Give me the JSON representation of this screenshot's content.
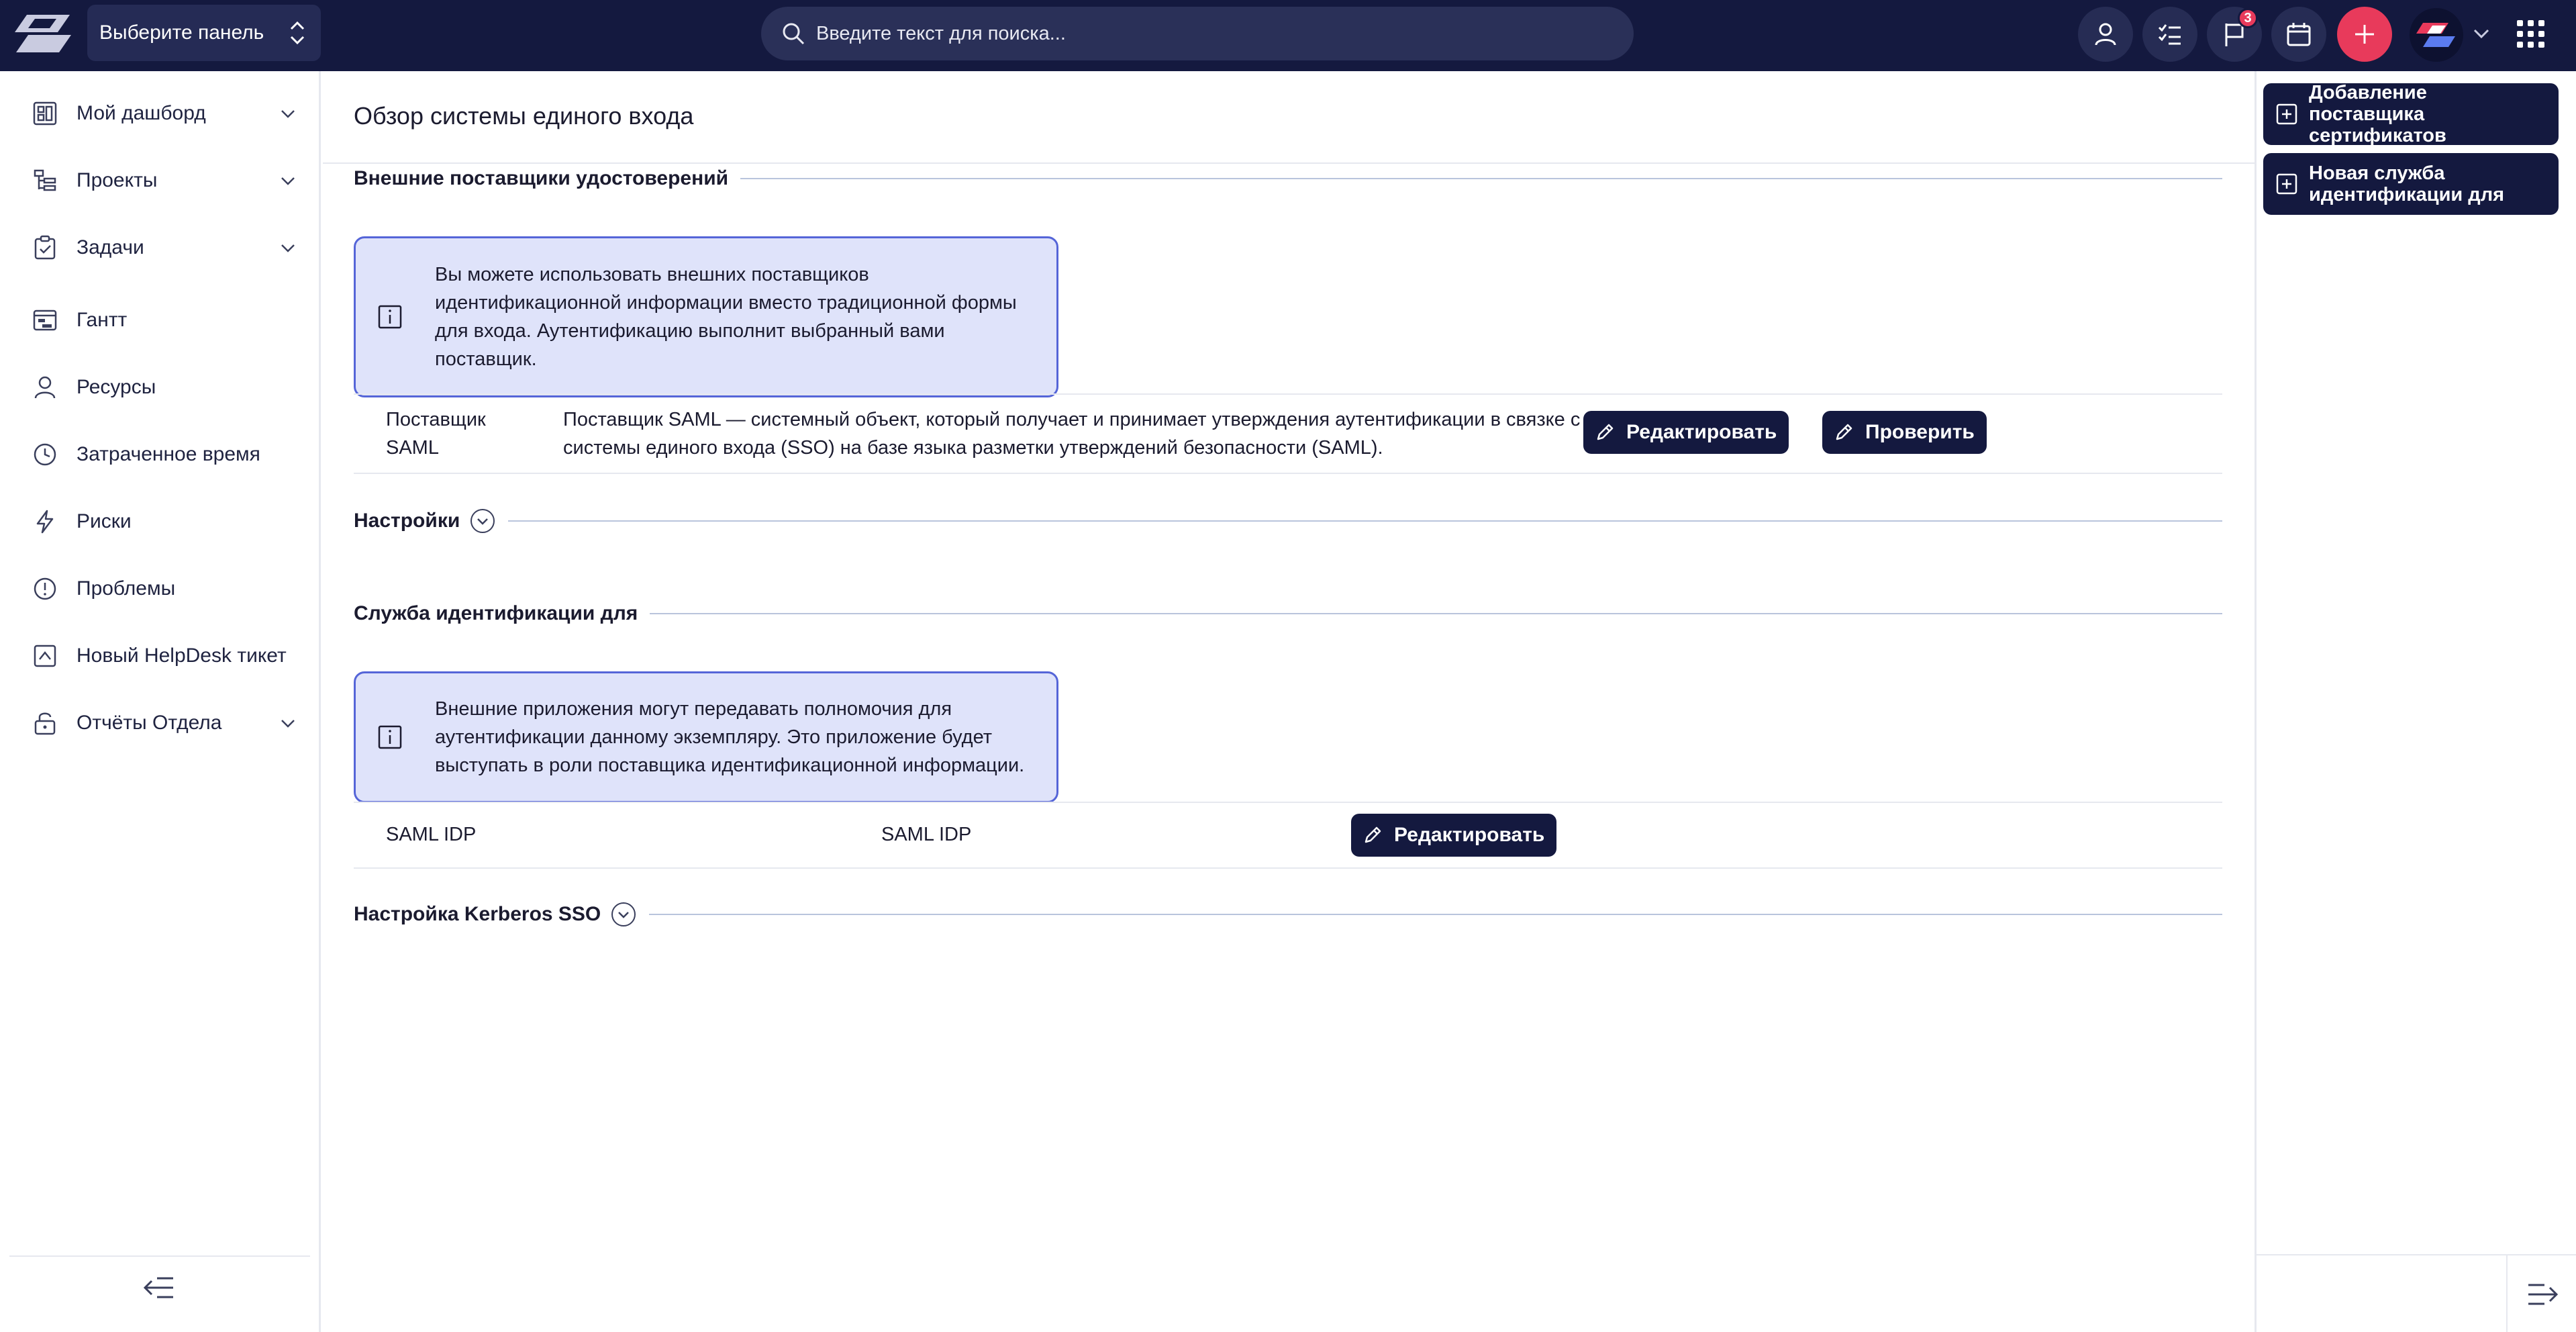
{
  "topbar": {
    "panel_select_label": "Выберите панель",
    "search_placeholder": "Введите текст для поиска...",
    "notifications_count": "3",
    "brand_color": "#14193f",
    "accent_color": "#e83a5b"
  },
  "sidebar": {
    "items": [
      {
        "label": "Мой дашборд",
        "icon": "dashboard-icon",
        "expandable": true
      },
      {
        "label": "Проекты",
        "icon": "projects-icon",
        "expandable": true
      },
      {
        "label": "Задачи",
        "icon": "tasks-icon",
        "expandable": true
      },
      {
        "label": "Гантт",
        "icon": "gantt-icon",
        "expandable": false
      },
      {
        "label": "Ресурсы",
        "icon": "user-icon",
        "expandable": false
      },
      {
        "label": "Затраченное время",
        "icon": "clock-icon",
        "expandable": false
      },
      {
        "label": "Риски",
        "icon": "lightning-icon",
        "expandable": false
      },
      {
        "label": "Проблемы",
        "icon": "alert-circle-icon",
        "expandable": false
      },
      {
        "label": "Новый HelpDesk тикет",
        "icon": "helpdesk-icon",
        "expandable": false
      },
      {
        "label": "Отчёты Отдела",
        "icon": "lock-report-icon",
        "expandable": true
      }
    ]
  },
  "main": {
    "title": "Обзор системы единого входа",
    "idp_section": {
      "title": "Внешние поставщики удостоверений",
      "info": "Вы можете использовать внешних поставщиков идентификационной информации вместо традиционной формы для входа. Аутентификацию выполнит выбранный вами поставщик.",
      "row": {
        "name": "Поставщик SAML",
        "description": "Поставщик SAML — системный объект, который получает и принимает утверждения аутентификации в связке с профилем системы единого входа (SSO) на базе языка разметки утверждений безопасности (SAML).",
        "edit_label": "Редактировать",
        "check_label": "Проверить"
      }
    },
    "settings_section": {
      "title": "Настройки"
    },
    "service_section": {
      "title": "Служба идентификации для",
      "info": "Внешние приложения могут передавать полномочия для аутентификации данному экземпляру. Это приложение будет выступать в роли поставщика идентификационной информации.",
      "row": {
        "name": "SAML IDP",
        "type": "SAML IDP",
        "edit_label": "Редактировать"
      }
    },
    "kerberos_section": {
      "title": "Настройка Kerberos SSO"
    }
  },
  "right_panel": {
    "add_cert_provider": "Добавление поставщика сертификатов",
    "new_identity_service": "Новая служба идентификации для"
  }
}
